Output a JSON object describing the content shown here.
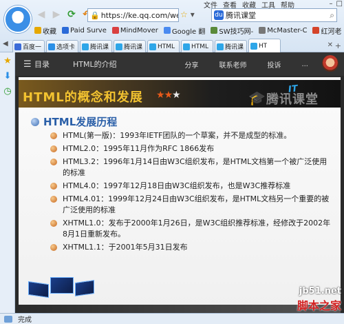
{
  "browser": {
    "address": "https://ke.qq.com/webcc",
    "search_text": "腾讯课堂",
    "menu": [
      "文件",
      "查看",
      "收藏",
      "工具",
      "帮助"
    ],
    "bookmarks": [
      {
        "label": "收藏",
        "icon": "star-icon",
        "color": "#e6a800"
      },
      {
        "label": "Paid Surve",
        "icon": "bookmark-icon",
        "color": "#2b6bd8"
      },
      {
        "label": "MindMover",
        "icon": "bookmark-icon",
        "color": "#d94040"
      },
      {
        "label": "Google 翻",
        "icon": "google-icon",
        "color": "#4a8af0"
      },
      {
        "label": "SW技巧网-",
        "icon": "bookmark-icon",
        "color": "#5a8a3a"
      },
      {
        "label": "McMaster-C",
        "icon": "bookmark-icon",
        "color": "#777777"
      },
      {
        "label": "红河老",
        "icon": "bookmark-icon",
        "color": "#d4442a"
      }
    ],
    "tabs": [
      {
        "label": "百度一",
        "color": "#3b6bd8"
      },
      {
        "label": "选项卡",
        "color": "#2b8fe6"
      },
      {
        "label": "腾讯课",
        "color": "#2ea6e8"
      },
      {
        "label": "腾讯课",
        "color": "#2ea6e8"
      },
      {
        "label": "HTML",
        "color": "#2ea6e8"
      },
      {
        "label": "HTML",
        "color": "#2ea6e8"
      },
      {
        "label": "腾讯课",
        "color": "#2ea6e8"
      },
      {
        "label": "HT",
        "color": "#2ea6e8"
      }
    ],
    "status_text": "完成"
  },
  "header": {
    "menu_label": "目录",
    "course_title": "HTML的介绍",
    "links": [
      "分享",
      "联系老师",
      "投诉",
      "..."
    ]
  },
  "slide": {
    "title": "HTML的概念和发展",
    "stars": "★★★",
    "brand_text": "腾讯课堂",
    "logo_text": "IT",
    "section_title": "HTML发展历程",
    "items": [
      "HTML(第一版)：1993年IETF团队的一个草案，并不是成型的标准。",
      "HTML2.0：1995年11月作为RFC 1866发布",
      "HTML3.2：1996年1月14日由W3C组织发布，是HTML文档第一个被广泛使用的标准",
      "HTML4.0：1997年12月18日由W3C组织发布，也是W3C推荐标准",
      "HTML4.01：1999年12月24日由W3C组织发布，是HTML文档另一个重要的被广泛使用的标准",
      "XHTML1.0：发布于2000年1月26日，是W3C组织推荐标准，经修改于2002年8月1日重新发布。",
      "XHTML1.1：于2001年5月31日发布"
    ],
    "watermark_url": "jb51.net",
    "watermark_name": "脚本之家"
  }
}
